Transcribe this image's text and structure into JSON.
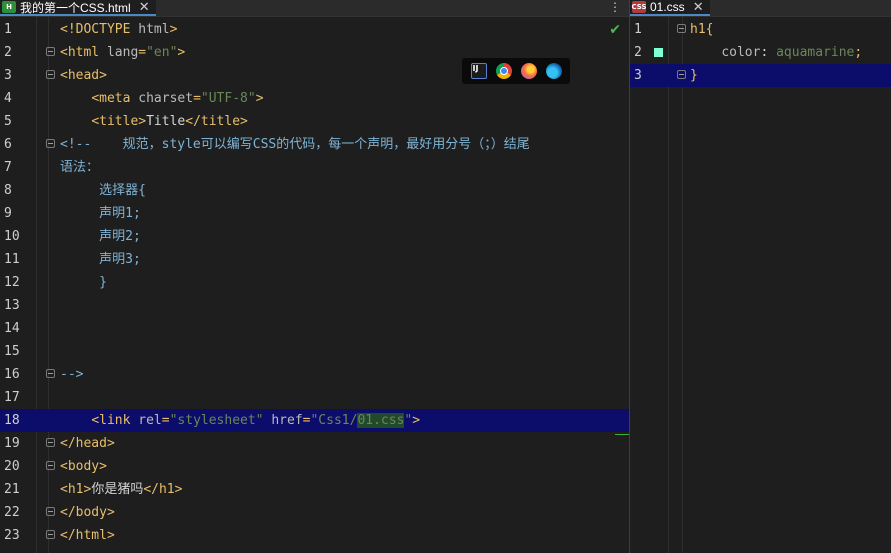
{
  "left_tab": {
    "icon": "html-file-icon",
    "title": "我的第一个CSS.html",
    "close": "✕",
    "menu": "⋮"
  },
  "right_tab": {
    "icon": "css-file-icon",
    "title": "01.css",
    "close": "✕"
  },
  "browsers": [
    "intellij-icon",
    "chrome-icon",
    "firefox-icon",
    "edge-icon"
  ],
  "colors": {
    "swatch": "#7fffd4",
    "current_line": "#0c0c6a"
  },
  "left_lines": [
    {
      "n": "1",
      "parts": [
        [
          "tag",
          "<!DOCTYPE "
        ],
        [
          "attr",
          "html"
        ],
        [
          "tag",
          ">"
        ]
      ]
    },
    {
      "n": "2",
      "parts": [
        [
          "tag",
          "<html "
        ],
        [
          "attr",
          "lang"
        ],
        [
          "tag",
          "="
        ],
        [
          "str",
          "\"en\""
        ],
        [
          "tag",
          ">"
        ]
      ]
    },
    {
      "n": "3",
      "parts": [
        [
          "tag",
          "<head>"
        ]
      ]
    },
    {
      "n": "4",
      "parts": [
        [
          "txt",
          "    "
        ],
        [
          "tag",
          "<meta "
        ],
        [
          "attr",
          "charset"
        ],
        [
          "tag",
          "="
        ],
        [
          "str",
          "\"UTF-8\""
        ],
        [
          "tag",
          ">"
        ]
      ]
    },
    {
      "n": "5",
      "parts": [
        [
          "txt",
          "    "
        ],
        [
          "tag",
          "<title>"
        ],
        [
          "txt",
          "Title"
        ],
        [
          "tag",
          "</title>"
        ]
      ]
    },
    {
      "n": "6",
      "parts": [
        [
          "cmt",
          "<!--    规范，style可以编写CSS的代码，每一个声明，最好用分号（；）结尾"
        ]
      ]
    },
    {
      "n": "7",
      "parts": [
        [
          "cmt",
          "语法："
        ]
      ]
    },
    {
      "n": "8",
      "parts": [
        [
          "cmt",
          "     选择器{"
        ]
      ]
    },
    {
      "n": "9",
      "parts": [
        [
          "cmt",
          "     声明1;"
        ]
      ]
    },
    {
      "n": "10",
      "parts": [
        [
          "cmt",
          "     声明2;"
        ]
      ]
    },
    {
      "n": "11",
      "parts": [
        [
          "cmt",
          "     声明3;"
        ]
      ]
    },
    {
      "n": "12",
      "parts": [
        [
          "cmt",
          "     }"
        ]
      ]
    },
    {
      "n": "13",
      "parts": []
    },
    {
      "n": "14",
      "parts": []
    },
    {
      "n": "15",
      "parts": []
    },
    {
      "n": "16",
      "parts": [
        [
          "cmt",
          "-->"
        ]
      ]
    },
    {
      "n": "17",
      "parts": []
    },
    {
      "n": "18",
      "parts": [
        [
          "txt",
          "    "
        ],
        [
          "tag",
          "<link "
        ],
        [
          "attr",
          "rel"
        ],
        [
          "tag",
          "="
        ],
        [
          "str",
          "\"stylesheet\" "
        ],
        [
          "attr",
          "href"
        ],
        [
          "tag",
          "="
        ],
        [
          "str",
          "\"Css1/"
        ],
        [
          "hl",
          "01.css"
        ],
        [
          "str",
          "\""
        ],
        [
          "tag",
          ">"
        ]
      ]
    },
    {
      "n": "19",
      "parts": [
        [
          "tag",
          "</head>"
        ]
      ]
    },
    {
      "n": "20",
      "parts": [
        [
          "tag",
          "<body>"
        ]
      ]
    },
    {
      "n": "21",
      "parts": [
        [
          "tag",
          "<h1>"
        ],
        [
          "txt",
          "你是猪吗"
        ],
        [
          "tag",
          "</h1>"
        ]
      ]
    },
    {
      "n": "22",
      "parts": [
        [
          "tag",
          "</body>"
        ]
      ]
    },
    {
      "n": "23",
      "parts": [
        [
          "tag",
          "</html>"
        ]
      ]
    }
  ],
  "right_lines": [
    {
      "n": "1",
      "parts": [
        [
          "brace",
          "h1{"
        ]
      ]
    },
    {
      "n": "2",
      "parts": [
        [
          "txt",
          "    "
        ],
        [
          "prop",
          "color"
        ],
        [
          "txt",
          ": "
        ],
        [
          "val",
          "aquamarine"
        ],
        [
          "brace",
          ";"
        ]
      ]
    },
    {
      "n": "3",
      "parts": [
        [
          "brace",
          "}"
        ]
      ]
    }
  ]
}
